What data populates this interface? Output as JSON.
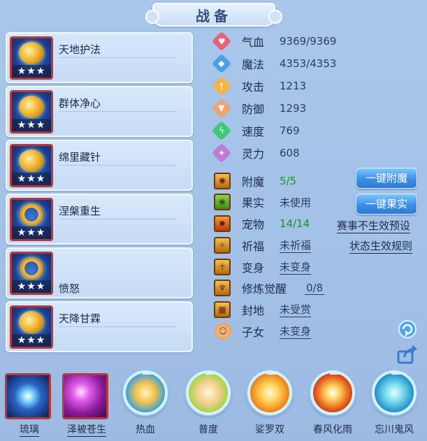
{
  "title": "战备",
  "skills": [
    {
      "name": "天地护法",
      "stars": "★★★"
    },
    {
      "name": "群体净心",
      "stars": "★★★"
    },
    {
      "name": "绵里藏针",
      "stars": "★★★"
    },
    {
      "name": "涅槃重生",
      "stars": "★★★"
    },
    {
      "name": "愤怒",
      "stars": "★★★"
    },
    {
      "name": "天降甘霖",
      "stars": "★★★"
    }
  ],
  "attributes": [
    {
      "label": "气血",
      "value": "9369/9369",
      "icon": "heart-icon",
      "color": "#e8607a"
    },
    {
      "label": "魔法",
      "value": "4353/4353",
      "icon": "mana-icon",
      "color": "#4aa0ea"
    },
    {
      "label": "攻击",
      "value": "1213",
      "icon": "sword-icon",
      "color": "#f2b544"
    },
    {
      "label": "防御",
      "value": "1293",
      "icon": "shield-icon",
      "color": "#f0a36a"
    },
    {
      "label": "速度",
      "value": "769",
      "icon": "lightning-icon",
      "color": "#3ec97a"
    },
    {
      "label": "灵力",
      "value": "608",
      "icon": "spirit-icon",
      "color": "#c07ad8"
    }
  ],
  "status": [
    {
      "label": "附魔",
      "value": "5/5",
      "icon": "enchant-icon"
    },
    {
      "label": "果实",
      "value": "未使用",
      "icon": "fruit-icon"
    },
    {
      "label": "宠物",
      "value": "14/14",
      "icon": "pet-icon"
    },
    {
      "label": "祈福",
      "value": "未祈福",
      "icon": "blessing-icon"
    },
    {
      "label": "变身",
      "value": "未变身",
      "icon": "transform-icon"
    },
    {
      "label": "修炼觉醒",
      "value": "0/8",
      "icon": "cultivation-icon"
    },
    {
      "label": "封地",
      "value": "未受赏",
      "icon": "fief-icon"
    },
    {
      "label": "子女",
      "value": "未变身",
      "icon": "child-icon"
    }
  ],
  "buttons": {
    "enchant": "一键附魔",
    "fruit": "一键果实"
  },
  "links": {
    "preset": "赛事不生效预设",
    "rules": "状态生效规则"
  },
  "bottom_skills": [
    {
      "label": "琉璃"
    },
    {
      "label": "泽被苍生"
    },
    {
      "label": "热血"
    },
    {
      "label": "普度"
    },
    {
      "label": "娑罗双"
    },
    {
      "label": "春风化雨"
    },
    {
      "label": "忘川鬼风"
    }
  ]
}
